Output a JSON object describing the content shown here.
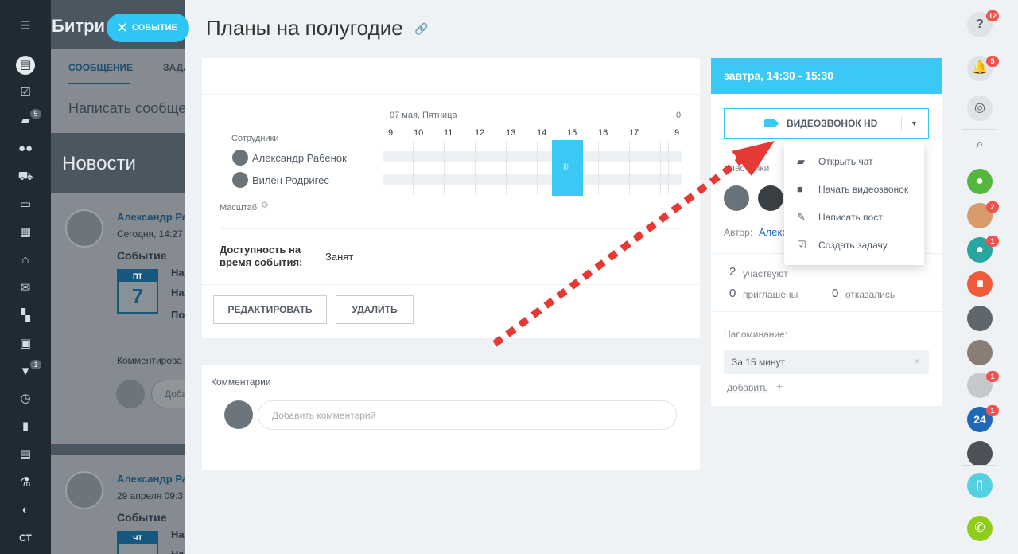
{
  "app": {
    "brand": "Битри",
    "event_pill": "событие"
  },
  "left_sidebar": {
    "badges": {
      "chat": "5",
      "filter": "1"
    },
    "footer_label": "СТ"
  },
  "bg_portal": {
    "tab_message": "СООБЩЕНИЕ",
    "tab_tasks": "ЗАДА",
    "write_placeholder": "Написать сообще",
    "news_title": "Новости",
    "post1": {
      "author": "Александр Ра",
      "date": "Сегодня, 14:27",
      "type": "Событие",
      "cal_dow": "ПТ",
      "cal_day": "7",
      "line_a": "На",
      "line_b": "На",
      "line_c": "По",
      "comments_label": "Комментирова",
      "add_stub": "Доба"
    },
    "post2": {
      "author": "Александр Ра",
      "date": "29 апреля 09:3",
      "type": "Событие",
      "cal_dow": "ЧТ",
      "line_a": "На",
      "line_b": "На"
    }
  },
  "event": {
    "title": "Планы на полугодие",
    "planner": {
      "date_label": "07 мая, Пятница",
      "next_date_stub": "0",
      "employees_label": "Сотрудники",
      "scale_label": "Масштаб",
      "hours": [
        "9",
        "10",
        "11",
        "12",
        "13",
        "14",
        "15",
        "16",
        "17",
        "9"
      ],
      "employees": [
        "Александр Рабенок",
        "Вилен Родригес"
      ],
      "selected_block_label": "|||"
    },
    "availability_label": "Доступность на время события:",
    "availability_value": "Занят",
    "buttons": {
      "edit": "Редактировать",
      "delete": "Удалить"
    },
    "comments": {
      "title": "Комментарии",
      "placeholder": "Добавить комментарий"
    }
  },
  "right_panel": {
    "time_header": "завтра, 14:30 - 15:30",
    "video_button": "Видеозвонок HD",
    "participants_label": "Участники",
    "author_label": "Автор:",
    "author_name": "Алекс",
    "stats": {
      "participate_count": "2",
      "participate_label": "участвуют",
      "invited_count": "0",
      "invited_label": "приглашены",
      "declined_count": "0",
      "declined_label": "отказались"
    },
    "reminder_label": "Напоминание:",
    "reminder_value": "За 15 минут",
    "add_label": "добавить"
  },
  "dropdown_menu": {
    "items": [
      "Открыть чат",
      "Начать видеозвонок",
      "Написать пост",
      "Создать задачу"
    ]
  },
  "right_bar": {
    "badges": {
      "help": "12",
      "notifications": "5",
      "avatar2": "2",
      "avatar3": "1",
      "avatar7": "1",
      "b24": "1"
    },
    "b24_label": "24"
  },
  "colors": {
    "accent": "#3bc8f5",
    "badge_red": "#ef5350",
    "annotation_red": "#e53935",
    "call_green": "#8fcd1d"
  }
}
